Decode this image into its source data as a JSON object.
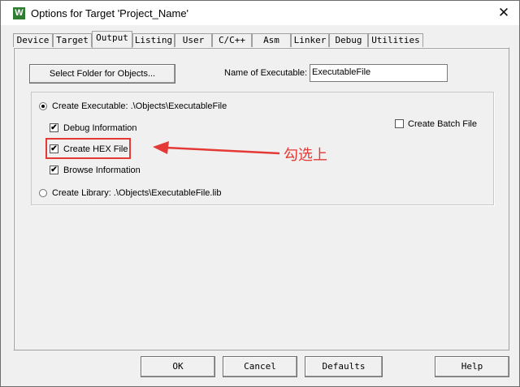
{
  "window": {
    "title": "Options for Target 'Project_Name'",
    "app_icon_letter": "W",
    "close_glyph": "✕"
  },
  "tabs": [
    {
      "label": "Device",
      "active": false
    },
    {
      "label": "Target",
      "active": false
    },
    {
      "label": "Output",
      "active": true
    },
    {
      "label": "Listing",
      "active": false
    },
    {
      "label": "User",
      "active": false
    },
    {
      "label": "C/C++",
      "active": false
    },
    {
      "label": "Asm",
      "active": false
    },
    {
      "label": "Linker",
      "active": false
    },
    {
      "label": "Debug",
      "active": false
    },
    {
      "label": "Utilities",
      "active": false
    }
  ],
  "output": {
    "select_folder_label": "Select Folder for Objects...",
    "name_of_executable_label": "Name of Executable:",
    "executable_name_value": "ExecutableFile",
    "create_executable_label": "Create Executable:  .\\Objects\\ExecutableFile",
    "create_executable_selected": true,
    "debug_info_label": "Debug Information",
    "debug_info_checked": true,
    "create_hex_label": "Create HEX File",
    "create_hex_checked": true,
    "browse_info_label": "Browse Information",
    "browse_info_checked": true,
    "create_batch_label": "Create Batch File",
    "create_batch_checked": false,
    "create_library_label": "Create Library:  .\\Objects\\ExecutableFile.lib",
    "create_library_selected": false
  },
  "annotation": {
    "text": "勾选上",
    "color": "#e53935"
  },
  "footer": {
    "ok_label": "OK",
    "cancel_label": "Cancel",
    "defaults_label": "Defaults",
    "help_label": "Help"
  },
  "check_glyph": "✔"
}
